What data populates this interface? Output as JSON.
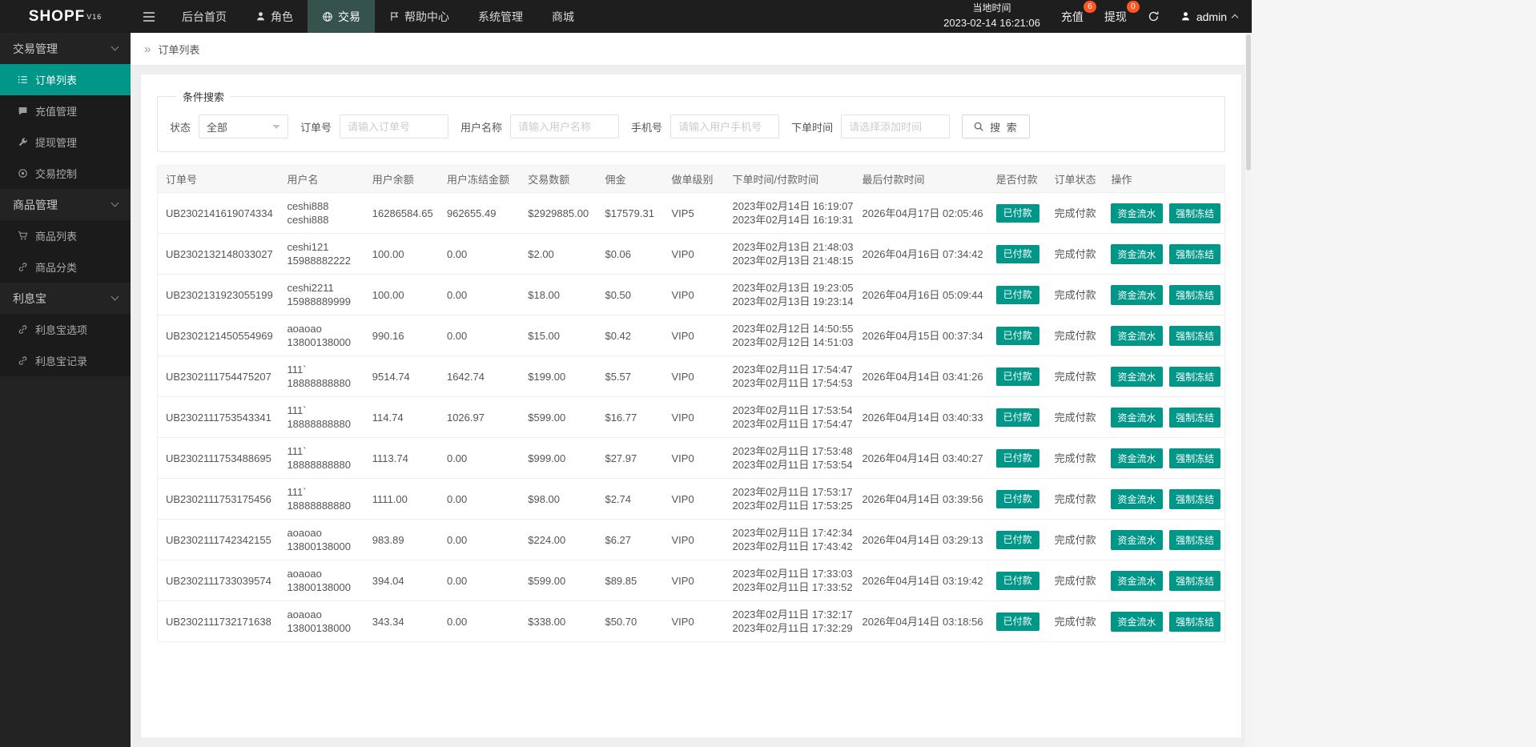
{
  "topbar": {
    "logo": "SHOPF",
    "logo_version": "V16",
    "nav": [
      {
        "label": "后台首页"
      },
      {
        "label": "角色"
      },
      {
        "label": "交易"
      },
      {
        "label": "帮助中心"
      },
      {
        "label": "系统管理"
      },
      {
        "label": "商城"
      }
    ],
    "local_time_label": "当地时间",
    "local_time_value": "2023-02-14 16:21:06",
    "recharge_label": "充值",
    "recharge_badge": "6",
    "withdraw_label": "提现",
    "withdraw_badge": "0",
    "admin_label": "admin"
  },
  "icons": {
    "breadcrumb_arrow": "»"
  },
  "sidebar": {
    "groups": [
      {
        "label": "交易管理",
        "items": [
          {
            "label": "订单列表"
          },
          {
            "label": "充值管理"
          },
          {
            "label": "提现管理"
          },
          {
            "label": "交易控制"
          }
        ]
      },
      {
        "label": "商品管理",
        "items": [
          {
            "label": "商品列表"
          },
          {
            "label": "商品分类"
          }
        ]
      },
      {
        "label": "利息宝",
        "items": [
          {
            "label": "利息宝选项"
          },
          {
            "label": "利息宝记录"
          }
        ]
      }
    ]
  },
  "breadcrumb": {
    "current": "订单列表"
  },
  "search": {
    "legend": "条件搜索",
    "status_label": "状态",
    "status_value": "全部",
    "order_no_label": "订单号",
    "order_no_placeholder": "请输入订单号",
    "username_label": "用户名称",
    "username_placeholder": "请输入用户名称",
    "phone_label": "手机号",
    "phone_placeholder": "请输入用户手机号",
    "order_time_label": "下单时间",
    "order_time_placeholder": "请选择添加时间",
    "search_button": "搜 索"
  },
  "table": {
    "headers": [
      "订单号",
      "用户名",
      "用户余额",
      "用户冻结金额",
      "交易数额",
      "佣金",
      "做单级别",
      "下单时间/付款时间",
      "最后付款时间",
      "是否付款",
      "订单状态",
      "操作"
    ],
    "labels": {
      "paid": "已付款",
      "status_done": "完成付款",
      "action_flow": "资金流水",
      "action_freeze": "强制冻结"
    },
    "rows": [
      {
        "order_no": "UB2302141619074334",
        "user_line1": "ceshi888",
        "user_line2": "ceshi888",
        "balance": "16286584.65",
        "frozen": "962655.49",
        "amount": "$2929885.00",
        "commission": "$17579.31",
        "level": "VIP5",
        "order_time": "2023年02月14日 16:19:07",
        "pay_time": "2023年02月14日 16:19:31",
        "last_pay_time": "2026年04月17日 02:05:46"
      },
      {
        "order_no": "UB2302132148033027",
        "user_line1": "ceshi121",
        "user_line2": "15988882222",
        "balance": "100.00",
        "frozen": "0.00",
        "amount": "$2.00",
        "commission": "$0.06",
        "level": "VIP0",
        "order_time": "2023年02月13日 21:48:03",
        "pay_time": "2023年02月13日 21:48:15",
        "last_pay_time": "2026年04月16日 07:34:42"
      },
      {
        "order_no": "UB2302131923055199",
        "user_line1": "ceshi2211",
        "user_line2": "15988889999",
        "balance": "100.00",
        "frozen": "0.00",
        "amount": "$18.00",
        "commission": "$0.50",
        "level": "VIP0",
        "order_time": "2023年02月13日 19:23:05",
        "pay_time": "2023年02月13日 19:23:14",
        "last_pay_time": "2026年04月16日 05:09:44"
      },
      {
        "order_no": "UB2302121450554969",
        "user_line1": "aoaoao",
        "user_line2": "13800138000",
        "balance": "990.16",
        "frozen": "0.00",
        "amount": "$15.00",
        "commission": "$0.42",
        "level": "VIP0",
        "order_time": "2023年02月12日 14:50:55",
        "pay_time": "2023年02月12日 14:51:03",
        "last_pay_time": "2026年04月15日 00:37:34"
      },
      {
        "order_no": "UB2302111754475207",
        "user_line1": "111`",
        "user_line2": "18888888880",
        "balance": "9514.74",
        "frozen": "1642.74",
        "amount": "$199.00",
        "commission": "$5.57",
        "level": "VIP0",
        "order_time": "2023年02月11日 17:54:47",
        "pay_time": "2023年02月11日 17:54:53",
        "last_pay_time": "2026年04月14日 03:41:26"
      },
      {
        "order_no": "UB2302111753543341",
        "user_line1": "111`",
        "user_line2": "18888888880",
        "balance": "114.74",
        "frozen": "1026.97",
        "amount": "$599.00",
        "commission": "$16.77",
        "level": "VIP0",
        "order_time": "2023年02月11日 17:53:54",
        "pay_time": "2023年02月11日 17:54:47",
        "last_pay_time": "2026年04月14日 03:40:33"
      },
      {
        "order_no": "UB2302111753488695",
        "user_line1": "111`",
        "user_line2": "18888888880",
        "balance": "1113.74",
        "frozen": "0.00",
        "amount": "$999.00",
        "commission": "$27.97",
        "level": "VIP0",
        "order_time": "2023年02月11日 17:53:48",
        "pay_time": "2023年02月11日 17:53:54",
        "last_pay_time": "2026年04月14日 03:40:27"
      },
      {
        "order_no": "UB2302111753175456",
        "user_line1": "111`",
        "user_line2": "18888888880",
        "balance": "1111.00",
        "frozen": "0.00",
        "amount": "$98.00",
        "commission": "$2.74",
        "level": "VIP0",
        "order_time": "2023年02月11日 17:53:17",
        "pay_time": "2023年02月11日 17:53:25",
        "last_pay_time": "2026年04月14日 03:39:56"
      },
      {
        "order_no": "UB2302111742342155",
        "user_line1": "aoaoao",
        "user_line2": "13800138000",
        "balance": "983.89",
        "frozen": "0.00",
        "amount": "$224.00",
        "commission": "$6.27",
        "level": "VIP0",
        "order_time": "2023年02月11日 17:42:34",
        "pay_time": "2023年02月11日 17:43:42",
        "last_pay_time": "2026年04月14日 03:29:13"
      },
      {
        "order_no": "UB2302111733039574",
        "user_line1": "aoaoao",
        "user_line2": "13800138000",
        "balance": "394.04",
        "frozen": "0.00",
        "amount": "$599.00",
        "commission": "$89.85",
        "level": "VIP0",
        "order_time": "2023年02月11日 17:33:03",
        "pay_time": "2023年02月11日 17:33:52",
        "last_pay_time": "2026年04月14日 03:19:42"
      },
      {
        "order_no": "UB2302111732171638",
        "user_line1": "aoaoao",
        "user_line2": "13800138000",
        "balance": "343.34",
        "frozen": "0.00",
        "amount": "$338.00",
        "commission": "$50.70",
        "level": "VIP0",
        "order_time": "2023年02月11日 17:32:17",
        "pay_time": "2023年02月11日 17:32:29",
        "last_pay_time": "2026年04月14日 03:18:56"
      }
    ]
  },
  "colors": {
    "accent": "#009688",
    "badge": "#ff5722",
    "topbar": "#1e1e1e",
    "sidebar": "#232323"
  }
}
